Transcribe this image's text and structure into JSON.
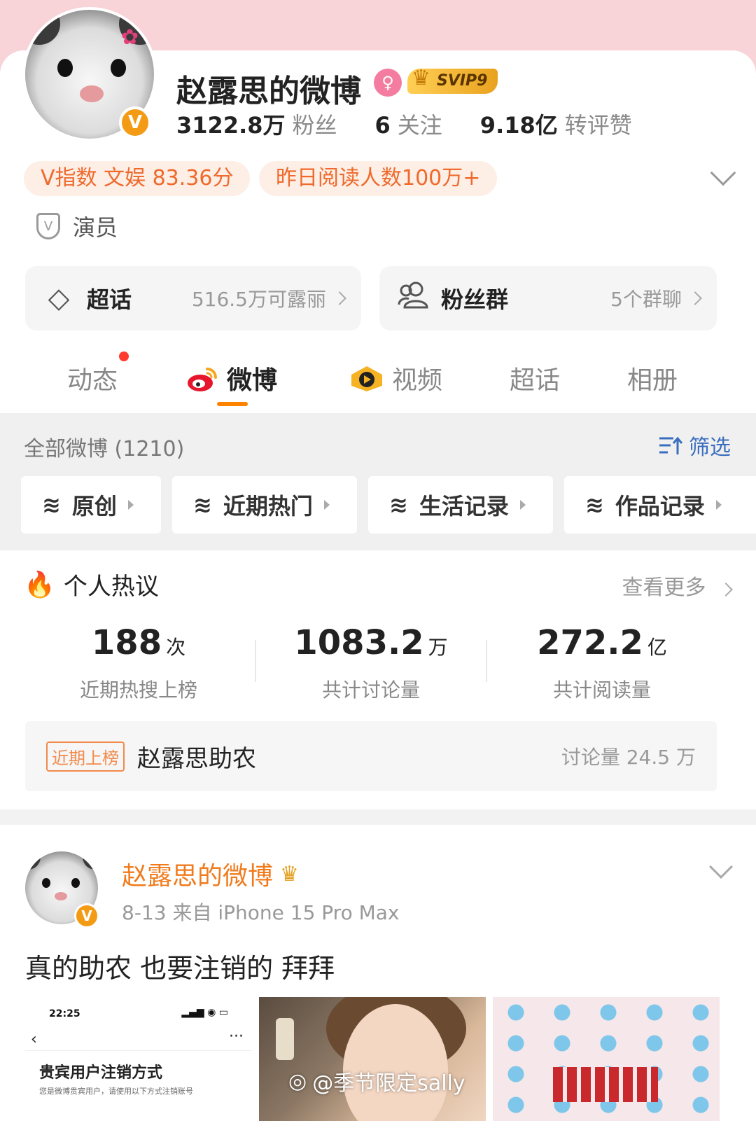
{
  "profile": {
    "name": "赵露思的微博",
    "svip": "SVIP9",
    "fans_num": "3122.8万",
    "fans_label": "粉丝",
    "follow_num": "6",
    "follow_label": "关注",
    "likes_num": "9.18亿",
    "likes_label": "转评赞",
    "v_badge": "V",
    "pills": [
      "V指数 文娱 83.36分",
      "昨日阅读人数100万+"
    ],
    "role": "演员",
    "role_shield": "V"
  },
  "entries": {
    "supertopic": {
      "label": "超话",
      "value": "516.5万可露丽"
    },
    "fangroup": {
      "label": "粉丝群",
      "value": "5个群聊"
    }
  },
  "tabs": [
    {
      "label": "动态"
    },
    {
      "label": "微博"
    },
    {
      "label": "视频"
    },
    {
      "label": "超话"
    },
    {
      "label": "相册"
    }
  ],
  "filter": {
    "all_label": "全部微博 (1210)",
    "filter_label": "筛选",
    "chips": [
      "原创",
      "近期热门",
      "生活记录",
      "作品记录"
    ]
  },
  "hot": {
    "title": "个人热议",
    "see_more": "查看更多",
    "stats": [
      {
        "num": "188",
        "unit": "次",
        "label": "近期热搜上榜"
      },
      {
        "num": "1083.2",
        "unit": "万",
        "label": "共计讨论量"
      },
      {
        "num": "272.2",
        "unit": "亿",
        "label": "共计阅读量"
      }
    ],
    "trend": {
      "tag": "近期上榜",
      "title": "赵露思助农",
      "count": "讨论量 24.5 万"
    }
  },
  "post": {
    "name": "赵露思的微博",
    "meta": "8-13  来自 iPhone 15 Pro Max",
    "text": "真的助农 也要注销的 拜拜",
    "thumb1": {
      "time": "22:25",
      "title": "贵宾用户注销方式",
      "subtitle": "您是微博贵宾用户，请使用以下方式注销账号"
    },
    "watermark": "@季节限定sally"
  },
  "colors": {
    "accent": "#ff8200",
    "pill_text": "#ef6a2c",
    "link_blue": "#3a6ebf",
    "top_bg": "#f8d3d8"
  }
}
